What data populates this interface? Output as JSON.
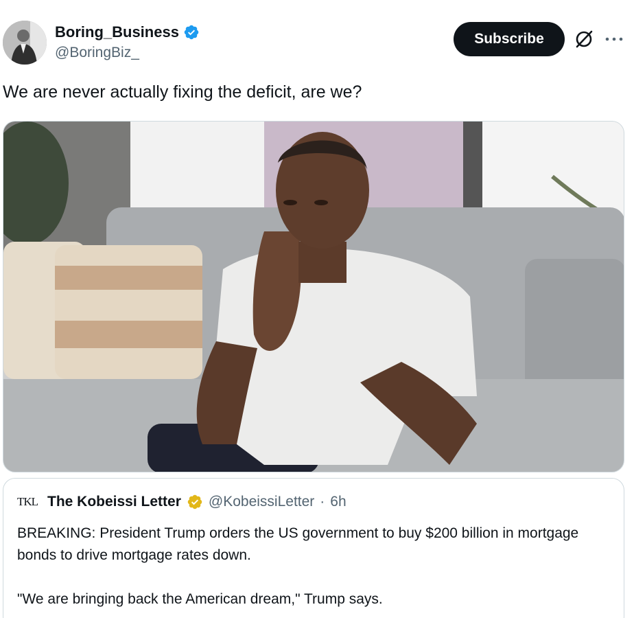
{
  "author": {
    "display_name": "Boring_Business",
    "handle": "@BoringBiz_",
    "verified": true,
    "verified_color": "#1d9bf0"
  },
  "actions": {
    "subscribe_label": "Subscribe",
    "grok_icon": "grok-icon",
    "more_icon": "more-icon"
  },
  "tweet": {
    "text": "We are never actually fixing the deficit, are we?"
  },
  "quoted_tweet": {
    "logo_text": "TKL",
    "display_name": "The Kobeissi Letter",
    "verified_color": "#e2b719",
    "handle": "@KobeissiLetter",
    "separator": "·",
    "time": "6h",
    "body_line1": "BREAKING: President Trump orders the US government to buy $200 billion in mortgage bonds to drive mortgage rates down.",
    "body_line2": "\"We are bringing back the American dream,\" Trump says."
  },
  "colors": {
    "text": "#0f1419",
    "secondary_text": "#536471",
    "border": "#cfd9de",
    "button_bg": "#0f1419"
  }
}
